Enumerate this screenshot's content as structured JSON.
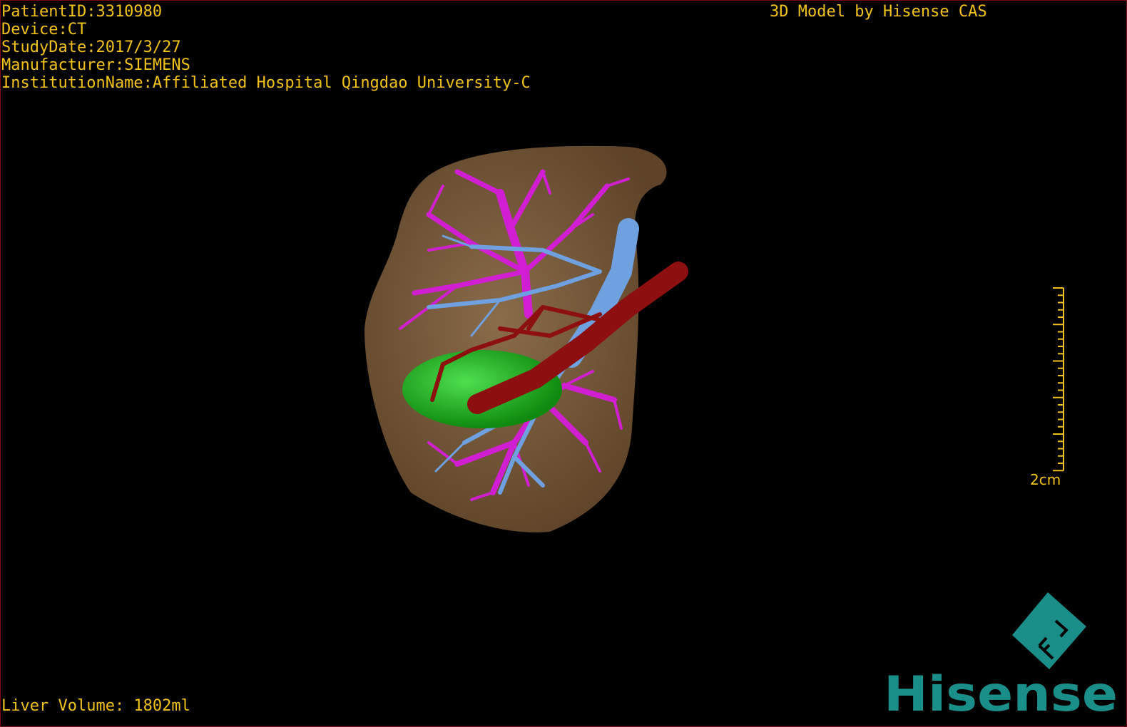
{
  "overlay": {
    "patient_id": "PatientID:3310980",
    "device": "Device:CT",
    "study_date": "StudyDate:2017/3/27",
    "manufacturer": "Manufacturer:SIEMENS",
    "institution": "InstitutionName:Affiliated Hospital Qingdao University-C",
    "brand_text": "3D Model by Hisense CAS",
    "liver_volume": "Liver Volume: 1802ml"
  },
  "scale_bar": {
    "label": "2cm"
  },
  "logo": {
    "text": "Hisense",
    "badge": "FL",
    "color": "#1a8f8a"
  },
  "colors": {
    "text": "#f2c21a",
    "liver": "#7a5e3e",
    "portal_vein": "#d21ed2",
    "hepatic_vein": "#6fa0e0",
    "artery": "#8e0f10",
    "lesion": "#1aa61a",
    "border": "#7a0a10"
  }
}
